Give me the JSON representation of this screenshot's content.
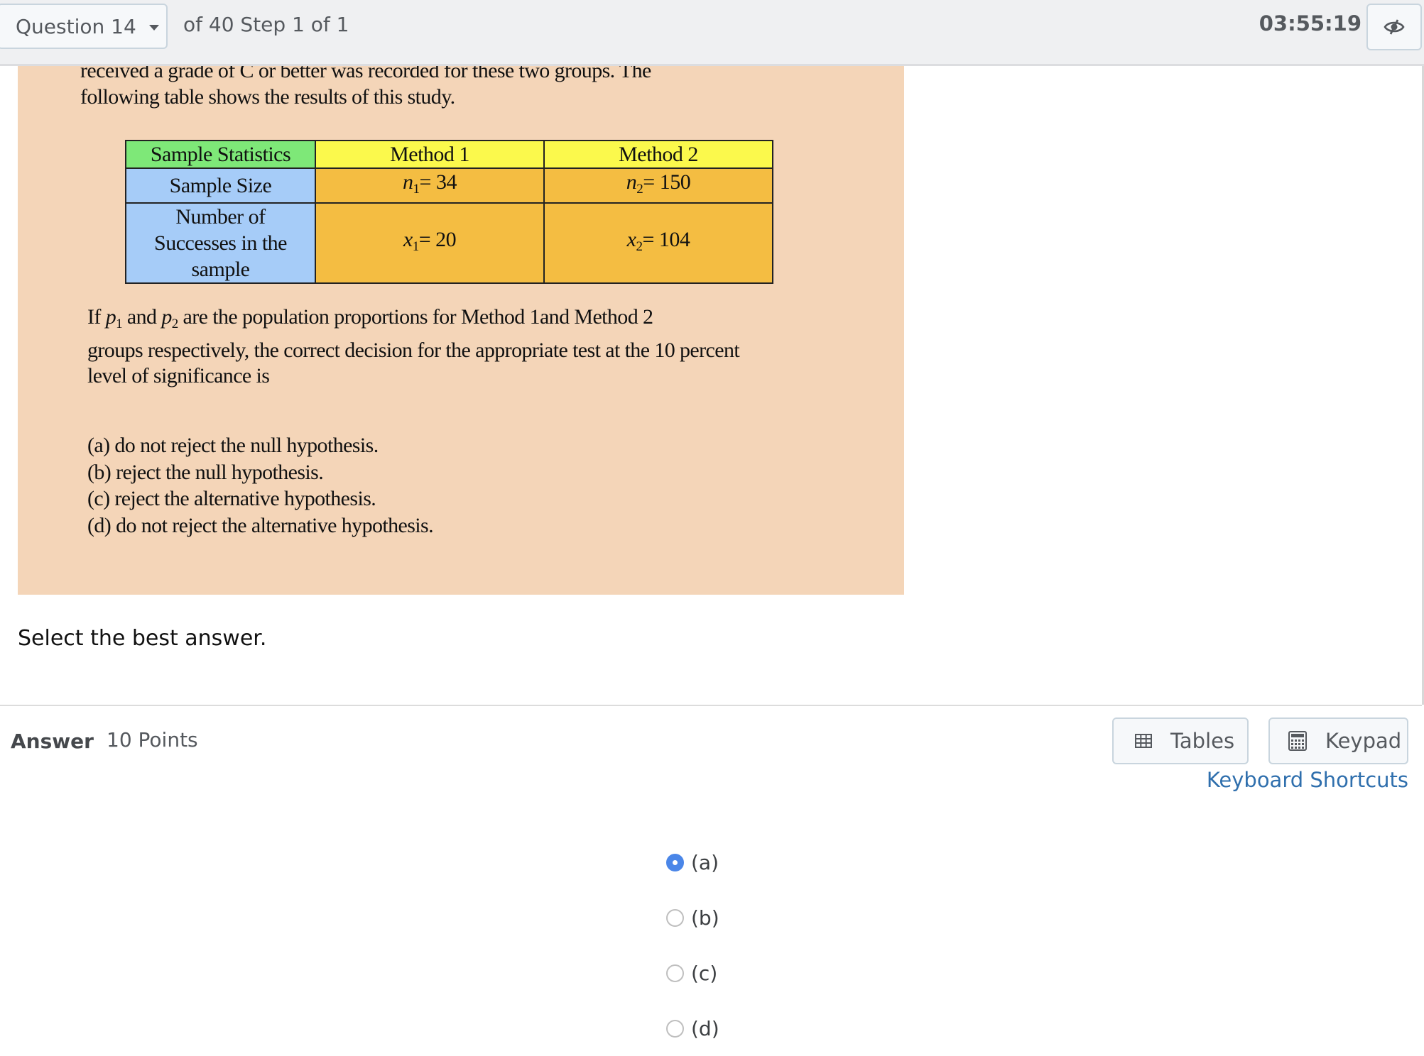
{
  "header": {
    "question_select": "Question 14",
    "question_of": "of 40 Step 1 of 1",
    "timer": "03:55:19",
    "hide_timer_icon": "eye-slash-icon"
  },
  "question": {
    "intro_line1": "received a grade of C or better was recorded for these two groups.  The",
    "intro_line2": "following table shows the results of this study.",
    "table": {
      "headers": [
        "Sample Statistics",
        "Method 1",
        "Method 2"
      ],
      "rows": [
        {
          "label": "Sample Size",
          "m1_var": "n",
          "m1_sub": "1",
          "m1_val": "= 34",
          "m2_var": "n",
          "m2_sub": "2",
          "m2_val": "= 150"
        },
        {
          "label_line1": "Number of",
          "label_line2": "Successes in the",
          "label_line3": "sample",
          "m1_var": "x",
          "m1_sub": "1",
          "m1_val": "= 20",
          "m2_var": "x",
          "m2_sub": "2",
          "m2_val": "= 104"
        }
      ]
    },
    "prompt": {
      "part1": "If ",
      "p1_var": "p",
      "p1_sub": "1",
      "part2": " and ",
      "p2_var": "p",
      "p2_sub": "2",
      "part3": " are the population proportions for Method 1and Method 2",
      "line2": "groups respectively, the correct decision for the appropriate test at the 10 percent",
      "line3": "level of significance is"
    },
    "choices": [
      "(a)  do not reject the null hypothesis.",
      "(b)  reject the null hypothesis.",
      "(c)  reject the alternative hypothesis.",
      "(d)  do not reject the alternative hypothesis."
    ]
  },
  "instruction": "Select the best answer.",
  "answer": {
    "label": "Answer",
    "points": "10 Points",
    "tables_button": "Tables",
    "keypad_button": "Keypad",
    "keyboard_shortcuts": "Keyboard Shortcuts",
    "options": [
      {
        "label": "(a)",
        "checked": true
      },
      {
        "label": "(b)",
        "checked": false
      },
      {
        "label": "(c)",
        "checked": false
      },
      {
        "label": "(d)",
        "checked": false
      }
    ]
  },
  "colors": {
    "question_bg": "#f4d5b8",
    "table_header_first": "#7ee878",
    "table_header": "#fbf94c",
    "table_label": "#a6ccf8",
    "table_value": "#f4bd42",
    "radio_selected": "#4a86e8",
    "link": "#2f6fad"
  }
}
